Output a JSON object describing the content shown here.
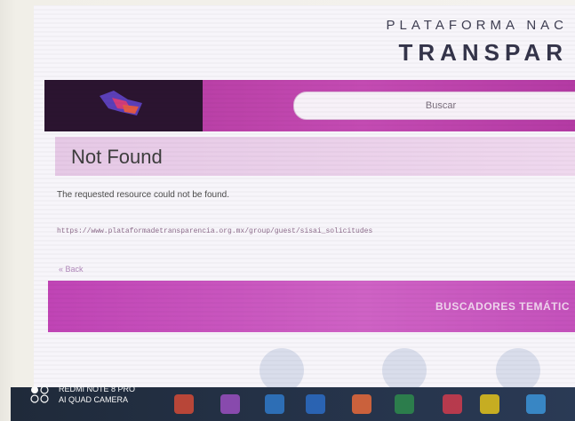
{
  "header": {
    "brand_line1": "PLATAFORMA NAC",
    "brand_line2": "TRANSPAR"
  },
  "nav": {
    "logo_icon": "logo-icon",
    "search_placeholder": "Buscar"
  },
  "error": {
    "title": "Not Found",
    "message": "The requested resource could not be found.",
    "url": "https://www.plataformadetransparencia.org.mx/group/guest/sisai_solicitudes",
    "back_link": "« Back"
  },
  "banner": {
    "label": "BUSCADORES TEMÁTIC"
  },
  "camera_watermark": {
    "line1": "REDMI NOTE 8 PRO",
    "line2": "AI QUAD CAMERA"
  },
  "colors": {
    "accent_magenta": "#c044b5",
    "logo_background": "#2b1430"
  }
}
